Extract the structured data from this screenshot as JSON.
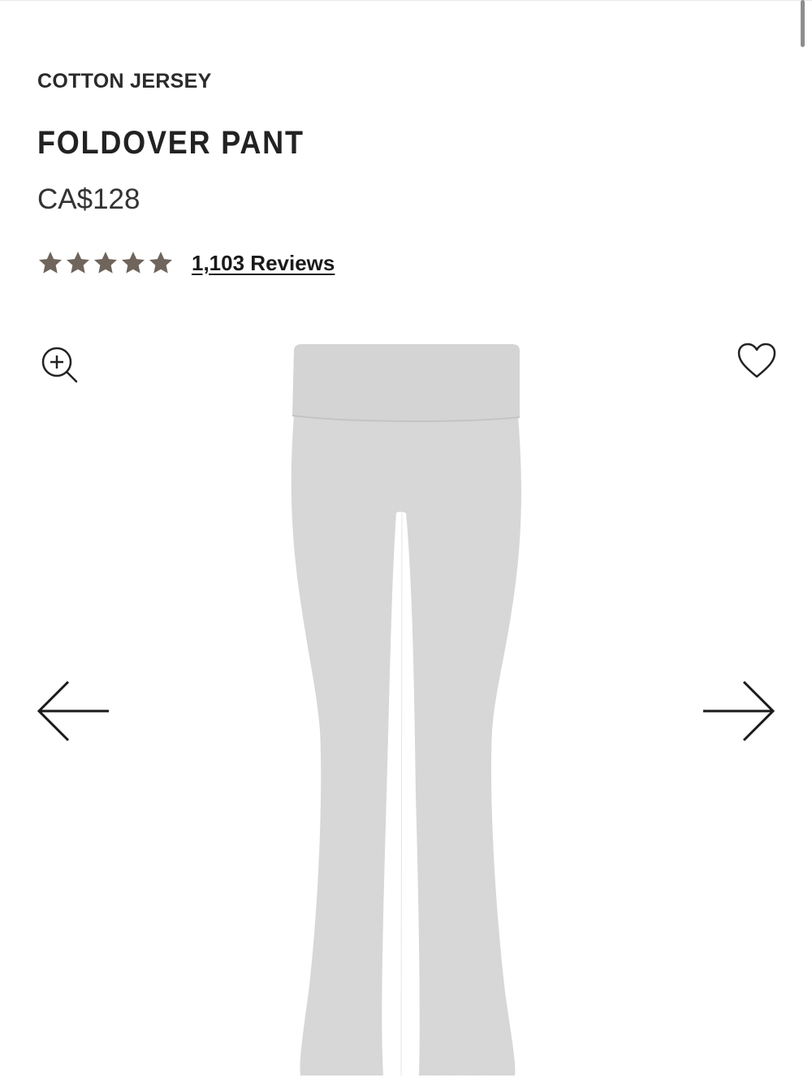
{
  "product": {
    "collection": "COTTON JERSEY",
    "name": "FOLDOVER PANT",
    "price": "CA$128",
    "rating": 5,
    "rating_max": 5,
    "reviews_label": "1,103 Reviews",
    "image_alt": "Heather grey foldover pant"
  },
  "colors": {
    "star": "#6f655c",
    "fabric": "#d8d8d8",
    "text": "#222222"
  },
  "icons": {
    "zoom": "zoom-in-icon",
    "wishlist": "heart-icon",
    "prev": "arrow-left-icon",
    "next": "arrow-right-icon"
  }
}
